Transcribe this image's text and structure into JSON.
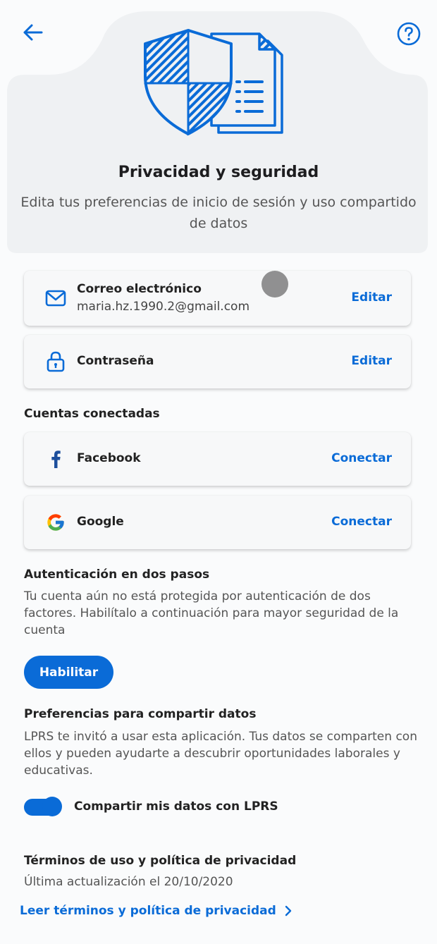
{
  "header": {
    "title": "Privacidad y seguridad",
    "subtitle": "Edita tus preferencias de inicio de sesión y uso compartido de datos"
  },
  "login": {
    "email": {
      "title": "Correo electrónico",
      "value": "maria.hz.1990.2@gmail.com",
      "action": "Editar"
    },
    "password": {
      "title": "Contraseña",
      "action": "Editar"
    }
  },
  "connected_accounts": {
    "heading": "Cuentas conectadas",
    "facebook": {
      "title": "Facebook",
      "action": "Conectar"
    },
    "google": {
      "title": "Google",
      "action": "Conectar"
    }
  },
  "two_factor": {
    "heading": "Autenticación en dos pasos",
    "text": "Tu cuenta aún no está protegida por autenticación de dos factores. Habilítalo a continuación para mayor seguridad de la cuenta",
    "button": "Habilitar"
  },
  "data_sharing": {
    "heading": "Preferencias para compartir datos",
    "text": "LPRS te invitó a usar esta aplicación. Tus datos se comparten con ellos y pueden ayudarte a descubrir oportunidades laborales y educativas.",
    "toggle_label": "Compartir mis datos con LPRS",
    "toggle_on": true
  },
  "terms": {
    "heading": "Términos de uso y política de privacidad",
    "updated": "Última actualización el 20/10/2020",
    "link": "Leer términos y política de privacidad"
  },
  "colors": {
    "accent": "#0a6bd7",
    "hero_bg": "#eff1f3",
    "page_bg": "#fafbfc"
  },
  "icons": [
    "back-arrow-icon",
    "help-icon",
    "shield-document-illustration",
    "mail-icon",
    "lock-icon",
    "facebook-icon",
    "google-icon",
    "chevron-right-icon"
  ]
}
